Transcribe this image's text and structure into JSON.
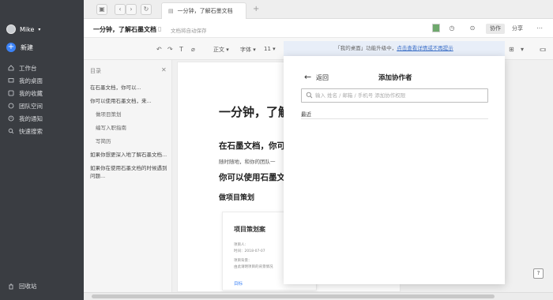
{
  "sidebar": {
    "user_name": "Mike",
    "new_label": "新建",
    "items": [
      {
        "label": "工作台",
        "icon": "home-icon"
      },
      {
        "label": "我的桌面",
        "icon": "desktop-icon"
      },
      {
        "label": "我的收藏",
        "icon": "star-icon"
      },
      {
        "label": "团队空间",
        "icon": "team-icon"
      },
      {
        "label": "我的通知",
        "icon": "bell-icon"
      },
      {
        "label": "快速搜索",
        "icon": "search-icon"
      }
    ],
    "trash_label": "回收站"
  },
  "tabbar": {
    "tab_title": "一分钟，了解石墨文档",
    "add_tab": "+"
  },
  "header": {
    "title": "一分钟，了解石墨文档",
    "autosave": "文档将自动保存",
    "collab_label": "协作",
    "share_label": "分享"
  },
  "toolbar": {
    "style": "正文",
    "font": "字体",
    "size": "11"
  },
  "outline": {
    "title": "目录",
    "items": [
      {
        "label": "在石墨文档，你可以...",
        "level": 1
      },
      {
        "label": "你可以使用石墨文档，来...",
        "level": 1
      },
      {
        "label": "做项目策划",
        "level": 2
      },
      {
        "label": "编写入职指南",
        "level": 2
      },
      {
        "label": "写简历",
        "level": 2
      },
      {
        "label": "如果你想更深入地了解石墨文档...",
        "level": 1
      },
      {
        "label": "如果你在使用石墨文档的时候遇到问题...",
        "level": 1
      }
    ]
  },
  "document": {
    "heading": "一分钟，了解",
    "section1": "在石墨文档，你可",
    "para1": "随时随地，和你的团队一",
    "section2": "你可以使用石墨文",
    "subsection": "做项目策划",
    "card": {
      "title": "项目策划案",
      "lines": [
        "项目人:",
        "时间：2018-07-07",
        "项目背景：",
        "由此请明项目的背景情况"
      ],
      "link": "目标"
    }
  },
  "banner": {
    "text": "「我的桌面」功能升级中，",
    "link": "点击查看详情或不再提示"
  },
  "dialog": {
    "back_label": "返回",
    "title": "添加协作者",
    "search_placeholder": "输入 姓名 / 邮箱 / 手机号 添加协作权限",
    "recent_label": "最近"
  },
  "help_label": "?"
}
